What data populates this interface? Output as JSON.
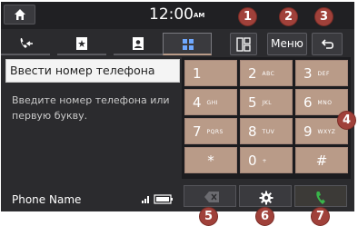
{
  "status_bar": {
    "time": "12:00",
    "ampm": "AM"
  },
  "tabs": [
    {
      "icon": "call-history-icon"
    },
    {
      "icon": "favorites-icon"
    },
    {
      "icon": "contacts-icon"
    },
    {
      "icon": "keypad-icon",
      "active": true
    }
  ],
  "toolbar": {
    "menu_label": "Меню",
    "split_icon": "split-screen-icon",
    "back_icon": "back-arrow-icon"
  },
  "dial": {
    "input_value": "Ввести номер телефона",
    "hint": "Введите номер телефона или первую букву."
  },
  "keypad": {
    "keys": [
      {
        "digit": "1",
        "letters": ""
      },
      {
        "digit": "2",
        "letters": "ABC"
      },
      {
        "digit": "3",
        "letters": "DEF"
      },
      {
        "digit": "4",
        "letters": "GHI"
      },
      {
        "digit": "5",
        "letters": "JKL"
      },
      {
        "digit": "6",
        "letters": "MNO"
      },
      {
        "digit": "7",
        "letters": "PQRS"
      },
      {
        "digit": "8",
        "letters": "TUV"
      },
      {
        "digit": "9",
        "letters": "WXYZ"
      },
      {
        "digit": "*",
        "letters": ""
      },
      {
        "digit": "0",
        "letters": "+"
      },
      {
        "digit": "#",
        "letters": ""
      }
    ]
  },
  "footer": {
    "phone_name": "Phone Name"
  },
  "callouts": [
    "1",
    "2",
    "3",
    "4",
    "5",
    "6",
    "7"
  ],
  "colors": {
    "key": "#b99b88",
    "badge": "#a0413a",
    "call": "#39b54a",
    "screen": "#2b2b2e"
  }
}
